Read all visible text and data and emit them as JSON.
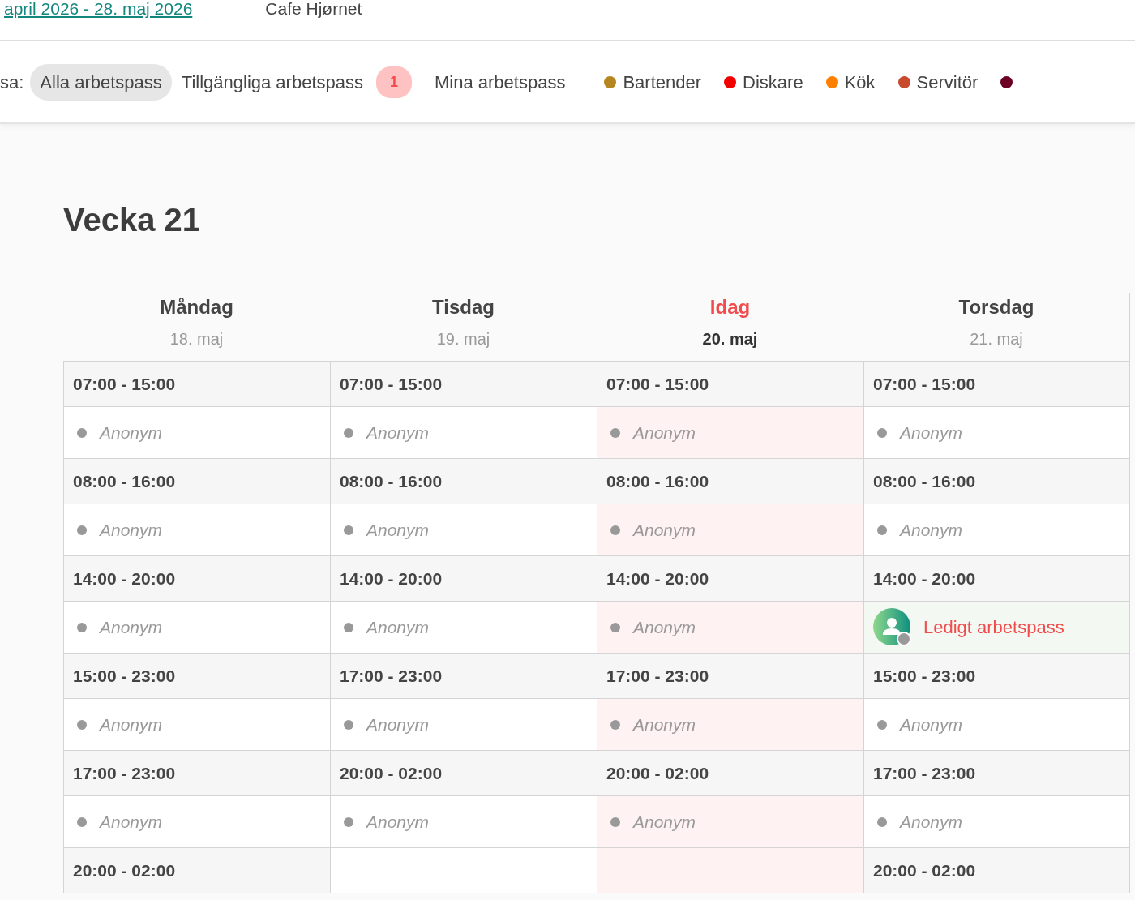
{
  "top_bar": {
    "period_link": "april 2026 - 28. maj 2026",
    "venue": "Cafe Hjørnet"
  },
  "filter": {
    "label": "sa:",
    "tabs": [
      {
        "label": "Alla arbetspass",
        "selected": true
      },
      {
        "label": "Tillgängliga arbetspass",
        "selected": false,
        "badge": "1"
      },
      {
        "label": "Mina arbetspass",
        "selected": false
      }
    ],
    "legend": [
      {
        "label": "Bartender",
        "color": "#b5851f"
      },
      {
        "label": "Diskare",
        "color": "#f20000"
      },
      {
        "label": "Kök",
        "color": "#ff7f00"
      },
      {
        "label": "Servitör",
        "color": "#c84b2e"
      },
      {
        "color": "#6b0024"
      }
    ]
  },
  "week": {
    "title": "Vecka 21",
    "days": [
      {
        "name": "Måndag",
        "date": "18. maj",
        "today": false,
        "shifts": [
          {
            "time": "07:00 - 15:00",
            "staff": {
              "kind": "anonymous",
              "label": "Anonym"
            }
          },
          {
            "time": "08:00 - 16:00",
            "staff": {
              "kind": "anonymous",
              "label": "Anonym"
            }
          },
          {
            "time": "14:00 - 20:00",
            "staff": {
              "kind": "anonymous",
              "label": "Anonym"
            }
          },
          {
            "time": "15:00 - 23:00",
            "staff": {
              "kind": "anonymous",
              "label": "Anonym"
            }
          },
          {
            "time": "17:00 - 23:00",
            "staff": {
              "kind": "anonymous",
              "label": "Anonym"
            }
          },
          {
            "time": "20:00 - 02:00"
          }
        ]
      },
      {
        "name": "Tisdag",
        "date": "19. maj",
        "today": false,
        "shifts": [
          {
            "time": "07:00 - 15:00",
            "staff": {
              "kind": "anonymous",
              "label": "Anonym"
            }
          },
          {
            "time": "08:00 - 16:00",
            "staff": {
              "kind": "anonymous",
              "label": "Anonym"
            }
          },
          {
            "time": "14:00 - 20:00",
            "staff": {
              "kind": "anonymous",
              "label": "Anonym"
            }
          },
          {
            "time": "17:00 - 23:00",
            "staff": {
              "kind": "anonymous",
              "label": "Anonym"
            }
          },
          {
            "time": "20:00 - 02:00",
            "staff": {
              "kind": "anonymous",
              "label": "Anonym"
            }
          }
        ]
      },
      {
        "name": "Idag",
        "date": "20. maj",
        "today": true,
        "shifts": [
          {
            "time": "07:00 - 15:00",
            "staff": {
              "kind": "anonymous",
              "label": "Anonym"
            }
          },
          {
            "time": "08:00 - 16:00",
            "staff": {
              "kind": "anonymous",
              "label": "Anonym"
            }
          },
          {
            "time": "14:00 - 20:00",
            "staff": {
              "kind": "anonymous",
              "label": "Anonym"
            }
          },
          {
            "time": "17:00 - 23:00",
            "staff": {
              "kind": "anonymous",
              "label": "Anonym"
            }
          },
          {
            "time": "20:00 - 02:00",
            "staff": {
              "kind": "anonymous",
              "label": "Anonym"
            }
          }
        ]
      },
      {
        "name": "Torsdag",
        "date": "21. maj",
        "today": false,
        "shifts": [
          {
            "time": "07:00 - 15:00",
            "staff": {
              "kind": "anonymous",
              "label": "Anonym"
            }
          },
          {
            "time": "08:00 - 16:00",
            "staff": {
              "kind": "anonymous",
              "label": "Anonym"
            }
          },
          {
            "time": "14:00 - 20:00",
            "staff": {
              "kind": "open",
              "label": "Ledigt arbetspass"
            }
          },
          {
            "time": "15:00 - 23:00",
            "staff": {
              "kind": "anonymous",
              "label": "Anonym"
            }
          },
          {
            "time": "17:00 - 23:00",
            "staff": {
              "kind": "anonymous",
              "label": "Anonym"
            }
          },
          {
            "time": "20:00 - 02:00"
          }
        ]
      }
    ]
  }
}
